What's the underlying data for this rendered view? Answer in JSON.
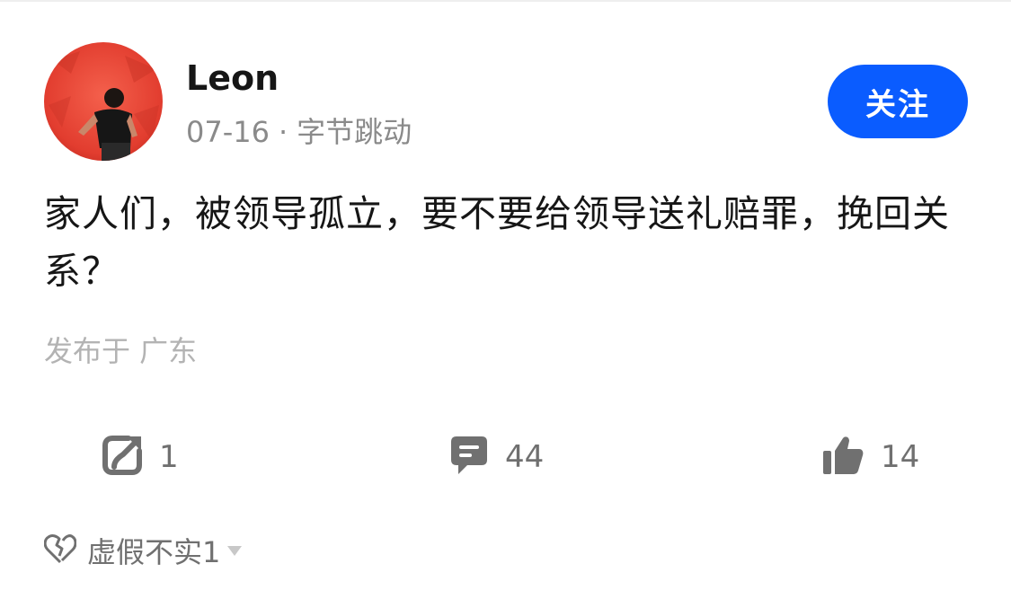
{
  "author": {
    "name": "Leon",
    "date": "07-16",
    "separator": "·",
    "company": "字节跳动",
    "follow_label": "关注"
  },
  "post": {
    "text": "家人们，被领导孤立，要不要给领导送礼赔罪，挽回关系？",
    "location": "发布于 广东"
  },
  "actions": {
    "repost_count": "1",
    "comment_count": "44",
    "like_count": "14"
  },
  "feedback": {
    "label": "虚假不实1"
  },
  "colors": {
    "accent": "#0a5cff",
    "icon_gray": "#707070",
    "avatar_bg": "#e8483a"
  },
  "icons": {
    "repost": "share-arrow-icon",
    "comment": "comment-bubble-icon",
    "like": "thumbs-up-icon",
    "feedback": "broken-heart-icon",
    "dropdown": "caret-down-icon"
  }
}
